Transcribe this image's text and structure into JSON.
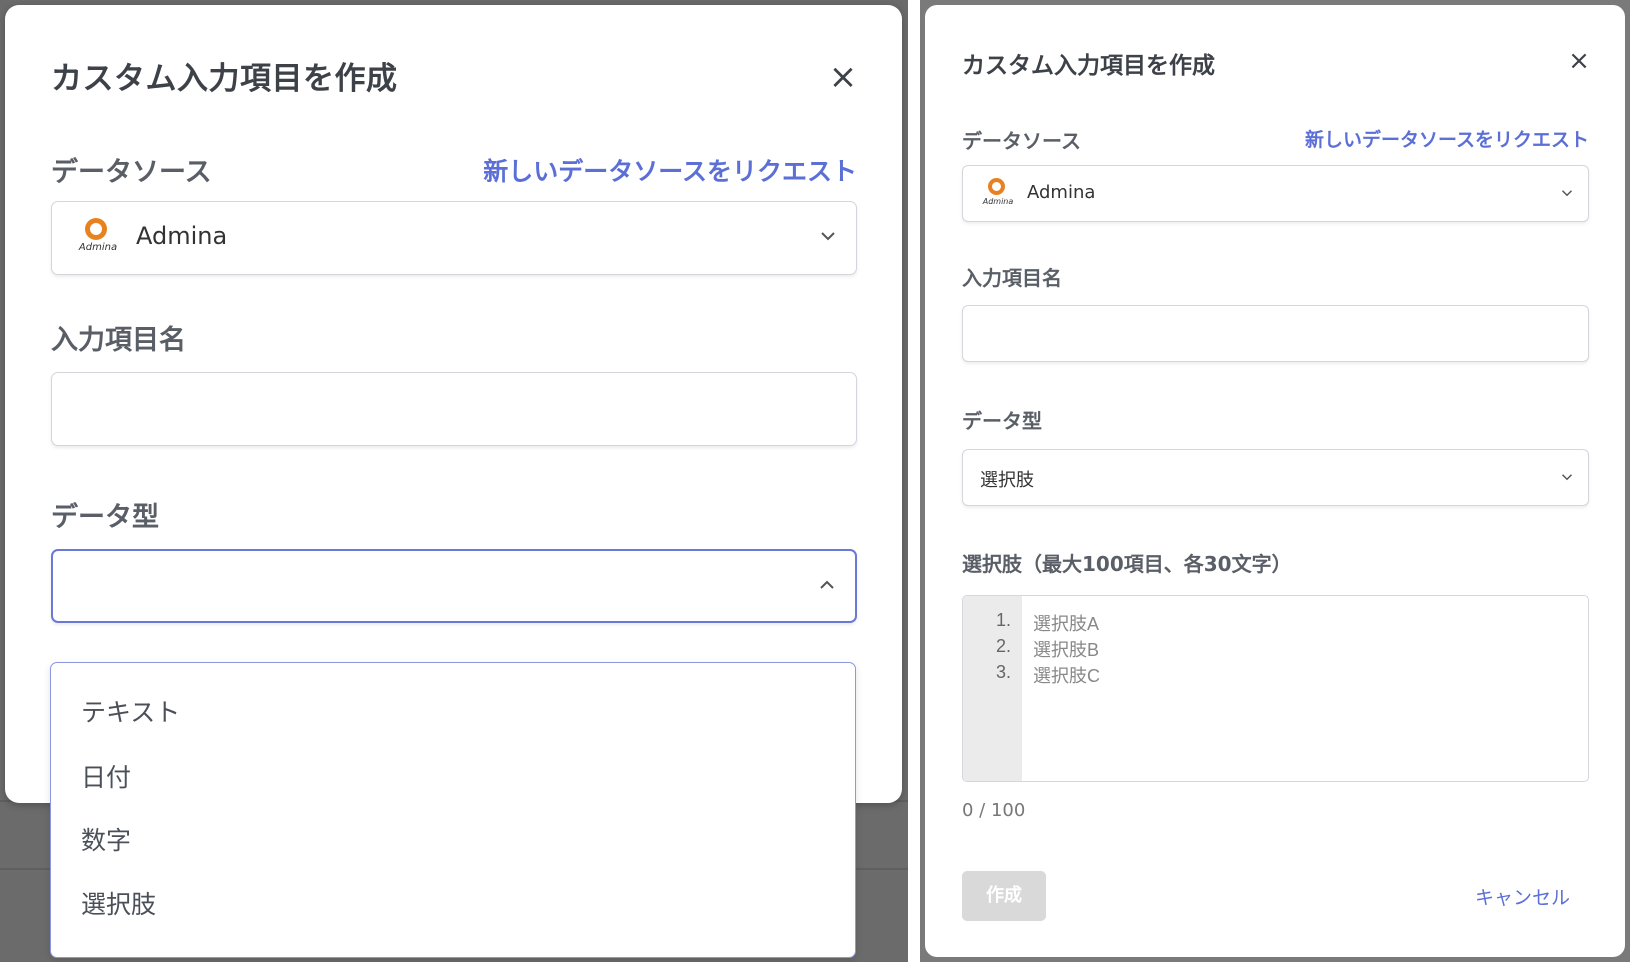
{
  "left": {
    "title": "カスタム入力項目を作成",
    "close_glyph": "×",
    "data_source_label": "データソース",
    "request_link": "新しいデータソースをリクエスト",
    "data_source_value": "Admina",
    "logo_text": "Admina",
    "field_name_label": "入力項目名",
    "field_name_value": "",
    "data_type_label": "データ型",
    "data_type_value": "",
    "dropdown_open": true,
    "options": [
      "テキスト",
      "日付",
      "数字",
      "選択肢"
    ]
  },
  "right": {
    "title": "カスタム入力項目を作成",
    "close_glyph": "×",
    "data_source_label": "データソース",
    "request_link": "新しいデータソースをリクエスト",
    "data_source_value": "Admina",
    "logo_text": "Admina",
    "field_name_label": "入力項目名",
    "field_name_value": "",
    "data_type_label": "データ型",
    "data_type_value": "選択肢",
    "choices_label": "選択肢（最大100項目、各30文字）",
    "choices_placeholder": [
      {
        "num": "1.",
        "text": "選択肢A"
      },
      {
        "num": "2.",
        "text": "選択肢B"
      },
      {
        "num": "3.",
        "text": "選択肢C"
      }
    ],
    "counter": "0 / 100",
    "create_label": "作成",
    "cancel_label": "キャンセル"
  },
  "colors": {
    "accent": "#5b6fd6",
    "brand_logo": "#e8821e",
    "disabled_button": "#d9d9d9"
  },
  "icons": {
    "close": "close-icon",
    "chevron_down": "chevron-down-icon",
    "chevron_up": "chevron-up-icon",
    "logo": "admina-logo"
  }
}
